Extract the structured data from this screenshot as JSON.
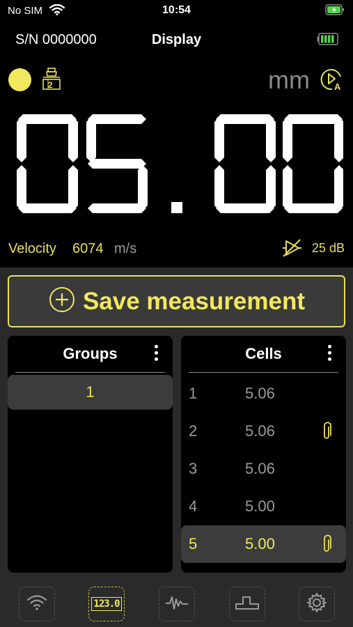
{
  "status_bar": {
    "carrier": "No SIM",
    "time": "10:54"
  },
  "header": {
    "serial": "S/N 0000000",
    "title": "Display"
  },
  "readout": {
    "value": "05.00",
    "unit": "mm"
  },
  "probe": {
    "channel": "2"
  },
  "velocity": {
    "label": "Velocity",
    "value": "6074",
    "unit": "m/s"
  },
  "gain": {
    "value": "25",
    "unit": "dB"
  },
  "save_button": {
    "label": "Save measurement"
  },
  "groups": {
    "title": "Groups",
    "items": [
      "1"
    ]
  },
  "cells": {
    "title": "Cells",
    "rows": [
      {
        "index": "1",
        "value": "5.06",
        "attachment": false
      },
      {
        "index": "2",
        "value": "5.06",
        "attachment": true
      },
      {
        "index": "3",
        "value": "5.06",
        "attachment": false
      },
      {
        "index": "4",
        "value": "5.00",
        "attachment": false
      },
      {
        "index": "5",
        "value": "5.00",
        "attachment": true
      }
    ],
    "selected_index": "5"
  },
  "tabbar": {
    "active_tab": "readout",
    "tabs": [
      "wifi-icon",
      "readout-123-icon",
      "waveform-icon",
      "step-icon",
      "gear-icon"
    ],
    "readout_tab_label": "123.0"
  },
  "colors": {
    "accent": "#f2e85d",
    "accent_dim": "#e8df5c",
    "panel": "#2a2a2a",
    "muted": "#9a9a9a"
  }
}
